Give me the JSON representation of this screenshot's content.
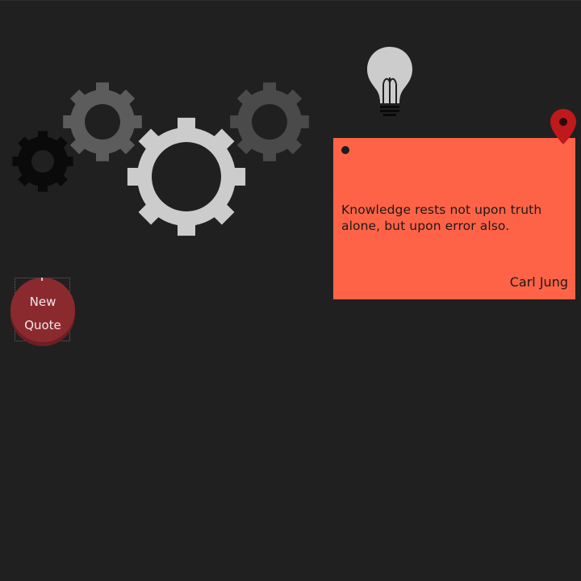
{
  "note": {
    "quote": "Knowledge rests not upon truth alone, but upon error also.",
    "author": "Carl Jung",
    "color": "#ff6347"
  },
  "button": {
    "line1": "New",
    "line2": "Quote",
    "color": "#8b2a2e"
  },
  "icons": {
    "gears": [
      "gear-icon",
      "gear-icon",
      "gear-icon",
      "gear-icon"
    ],
    "bulb": "lightbulb-icon",
    "pin": "map-pin-icon"
  },
  "colors": {
    "background": "#202020",
    "gear_black": "#0a0a0a",
    "gear_dark": "#5c5c5c",
    "gear_light": "#cccccc",
    "gear_mid": "#4a4a4a"
  }
}
